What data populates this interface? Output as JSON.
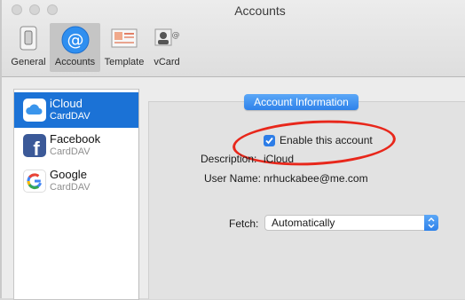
{
  "window": {
    "title": "Accounts"
  },
  "toolbar": {
    "items": [
      {
        "label": "General",
        "icon": "general-icon"
      },
      {
        "label": "Accounts",
        "icon": "at-sign-icon",
        "selected": true
      },
      {
        "label": "Template",
        "icon": "template-icon"
      },
      {
        "label": "vCard",
        "icon": "vcard-icon"
      }
    ]
  },
  "sidebar": {
    "accounts": [
      {
        "name": "iCloud",
        "type": "CardDAV",
        "icon": "icloud-icon",
        "selected": true
      },
      {
        "name": "Facebook",
        "type": "CardDAV",
        "icon": "facebook-icon"
      },
      {
        "name": "Google",
        "type": "CardDAV",
        "icon": "google-icon"
      }
    ]
  },
  "panel": {
    "header_label": "Account Information",
    "enable_label": "Enable this account",
    "enable_checked": true,
    "description_label": "Description:",
    "description_value": "iCloud",
    "username_label": "User Name:",
    "username_value": "nrhuckabee@me.com",
    "fetch_label": "Fetch:",
    "fetch_value": "Automatically"
  },
  "colors": {
    "accent": "#1b72d6",
    "highlight_oval": "#e8271b"
  }
}
